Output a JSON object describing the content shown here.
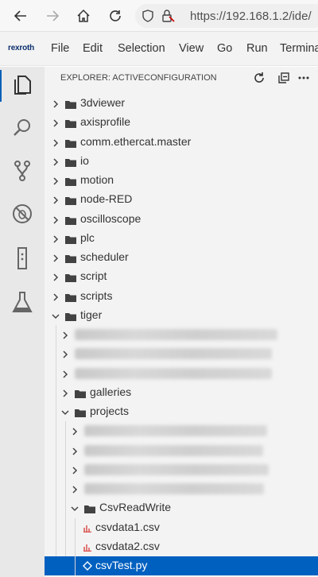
{
  "browser": {
    "url": "https://192.168.1.2/ide/"
  },
  "menubar": {
    "brand": "rexroth",
    "items": [
      "File",
      "Edit",
      "Selection",
      "View",
      "Go",
      "Run",
      "Terminal"
    ]
  },
  "activitybar": {
    "icons": [
      "explorer-icon",
      "search-icon",
      "source-control-icon",
      "debug-icon",
      "extensions-icon",
      "test-icon"
    ]
  },
  "explorer": {
    "title": "EXPLORER: ACTIVECONFIGURATION",
    "top_folders": [
      "3dviewer",
      "axisprofile",
      "comm.ethercat.master",
      "io",
      "motion",
      "node-RED",
      "oscilloscope",
      "plc",
      "scheduler",
      "script",
      "scripts",
      "tiger"
    ],
    "tiger_children": {
      "galleries": "galleries",
      "projects": "projects"
    },
    "projects_children": {
      "csvreadwrite": "CsvReadWrite"
    },
    "csv_files": [
      "csvdata1.csv",
      "csvdata2.csv",
      "csvTest.py"
    ]
  },
  "colors": {
    "accent": "#005fb8",
    "selection": "#0060c0",
    "csv_icon": "#d9534f"
  }
}
